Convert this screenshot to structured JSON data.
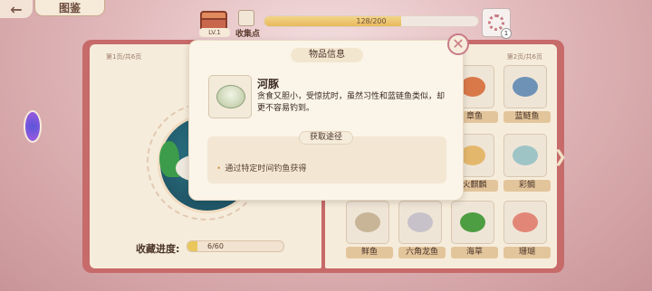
{
  "header": {
    "back_icon": "back-arrow-icon",
    "title": "图鉴",
    "chest_level": "LV.1",
    "collect_label": "收集点",
    "progress_text": "128/200",
    "progress_fraction": 0.64,
    "badge_count": "1"
  },
  "book": {
    "left_page_label": "第1页/共6页",
    "right_page_label": "第2页/共6页",
    "collection_progress_label": "收藏进度:",
    "collection_progress_text": "6/60",
    "collection_progress_fraction": 0.1
  },
  "items": [
    {
      "name": "章鱼",
      "color": "#d9794a"
    },
    {
      "name": "蓝鲢鱼",
      "color": "#6d92b5"
    },
    {
      "name": "火麒麟",
      "color": "#e4b86c"
    },
    {
      "name": "彩鲷",
      "color": "#9ec4c6"
    },
    {
      "name": "鲜鱼",
      "color": "#c8b597"
    },
    {
      "name": "六角龙鱼",
      "color": "#c7c2c9"
    },
    {
      "name": "海草",
      "color": "#4d9e42"
    },
    {
      "name": "珊瑚",
      "color": "#e28778"
    }
  ],
  "dialog": {
    "title": "物品信息",
    "close_icon": "close-icon",
    "item_name": "河豚",
    "item_desc": "贪食又胆小，受惊扰时，虽然习性和蓝链鱼类似，却更不容易钓到。",
    "source_title": "获取途径",
    "source_item": "通过特定时间钓鱼获得"
  },
  "colors": {
    "accent_pink": "#c97a86",
    "book_red": "#c76a6a",
    "progress_gold": "#e9c75d"
  }
}
